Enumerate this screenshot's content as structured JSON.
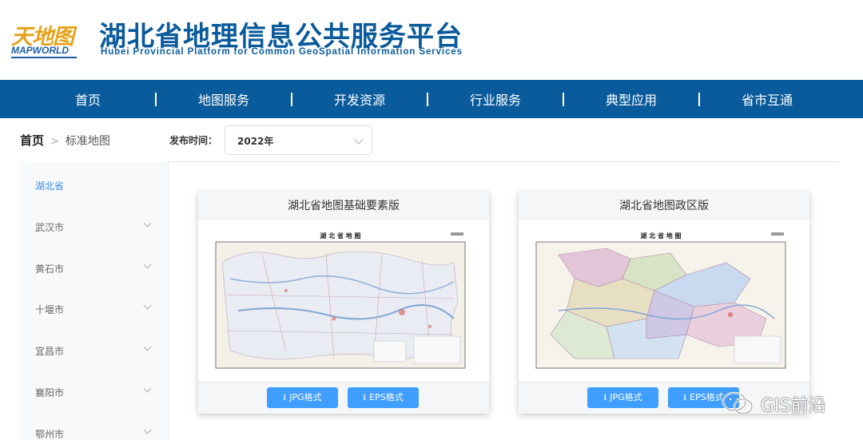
{
  "header": {
    "logo_cn": "天地图",
    "logo_en": "MAPWORLD",
    "title": "湖北省地理信息公共服务平台",
    "subtitle": "Hubei Provincial Platform for Common GeoSpatial Information Services"
  },
  "nav": {
    "items": [
      {
        "label": "首页"
      },
      {
        "label": "地图服务"
      },
      {
        "label": "开发资源"
      },
      {
        "label": "行业服务"
      },
      {
        "label": "典型应用"
      },
      {
        "label": "省市互通"
      }
    ]
  },
  "breadcrumb": {
    "home": "首页",
    "current": "标准地图"
  },
  "filter": {
    "label": "发布时间：",
    "selected": "2022年"
  },
  "sidebar": {
    "items": [
      {
        "label": "湖北省",
        "active": true
      },
      {
        "label": "武汉市"
      },
      {
        "label": "黄石市"
      },
      {
        "label": "十堰市"
      },
      {
        "label": "宜昌市"
      },
      {
        "label": "襄阳市"
      },
      {
        "label": "鄂州市"
      }
    ]
  },
  "cards": [
    {
      "title": "湖北省地图基础要素版",
      "map_title": "湖 北 省 地 图",
      "buttons": [
        {
          "label": "JPG格式"
        },
        {
          "label": "EPS格式"
        }
      ]
    },
    {
      "title": "湖北省地图政区版",
      "map_title": "湖 北 省 地 图",
      "buttons": [
        {
          "label": "JPG格式"
        },
        {
          "label": "EPS格式"
        }
      ]
    }
  ],
  "watermark": {
    "text": "GIS前沿",
    "icon": "wechat-icon"
  },
  "colors": {
    "brand_blue": "#0a5b9c",
    "accent_orange": "#e8a21a",
    "button_blue": "#409eff",
    "active_link": "#3a8ee6"
  }
}
